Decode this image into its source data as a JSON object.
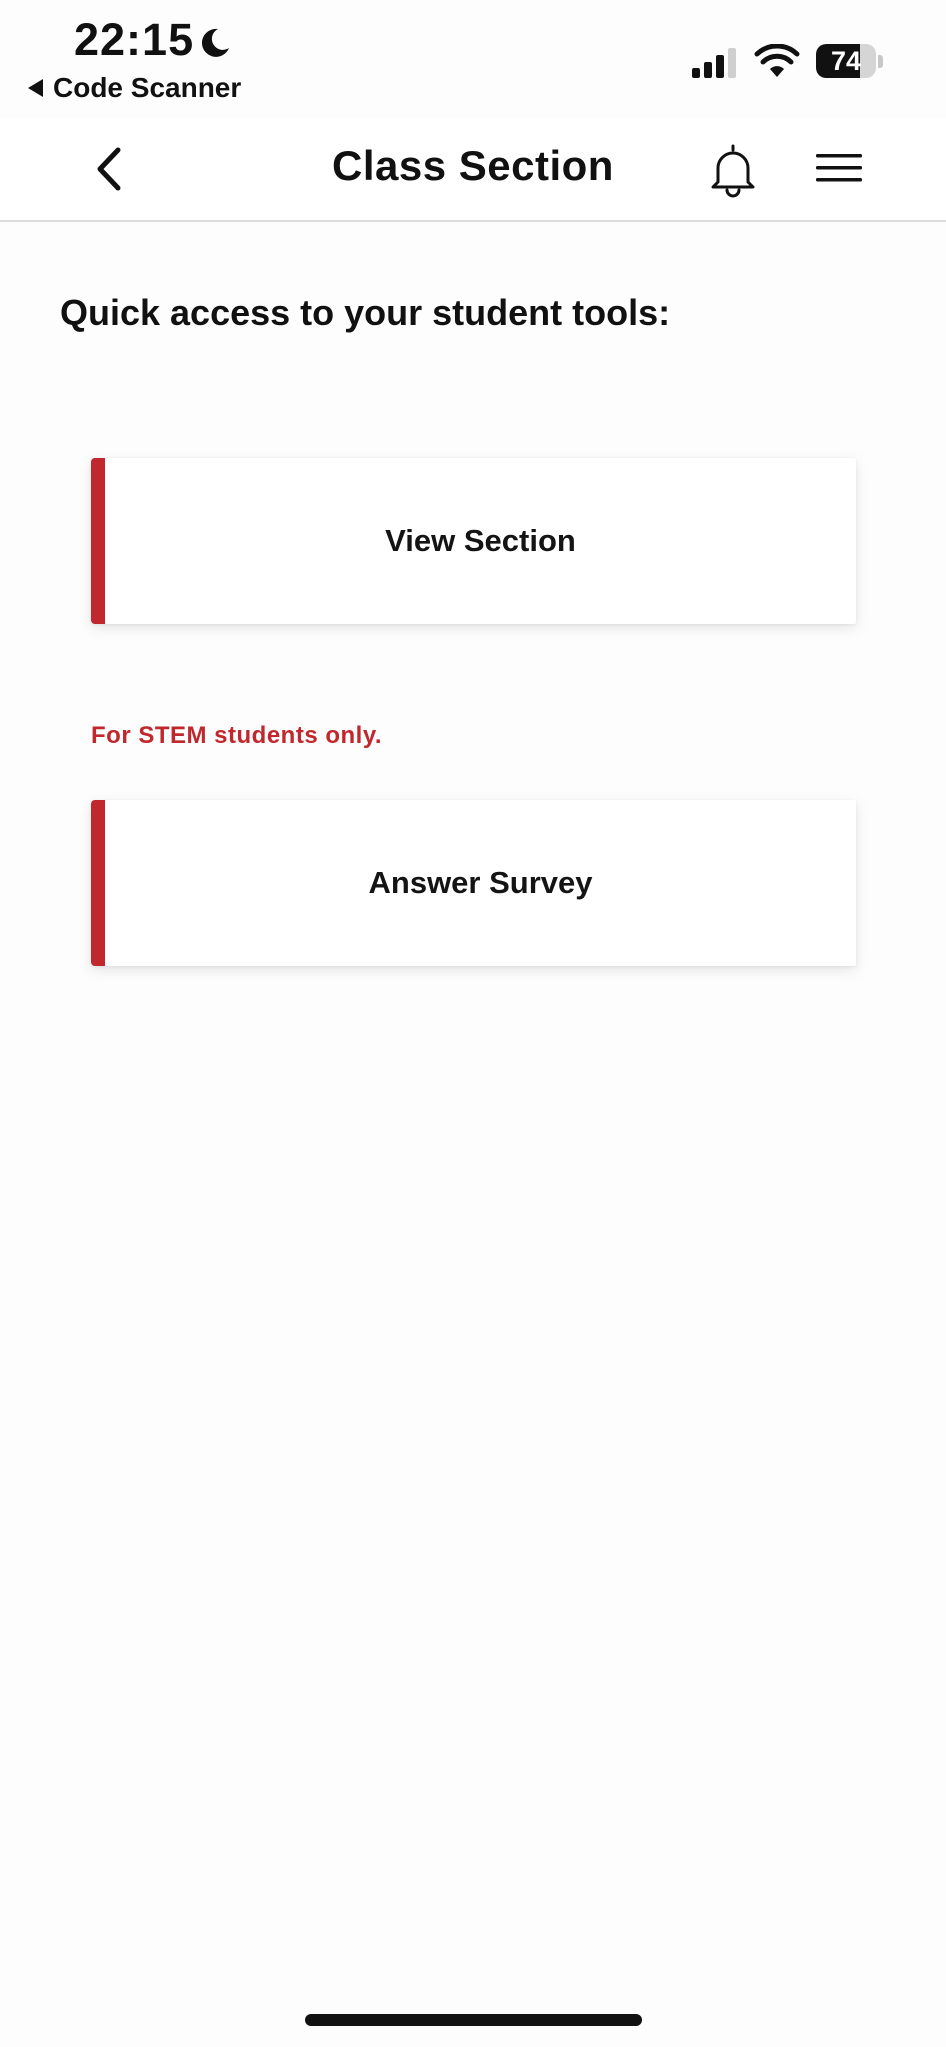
{
  "status_bar": {
    "time": "22:15",
    "back_app": "Code Scanner",
    "battery_level": "74",
    "battery_percent": 74,
    "icons": [
      "moon-icon",
      "signal-icon",
      "wifi-icon",
      "battery-icon"
    ]
  },
  "nav": {
    "title": "Class Section",
    "back_icon": "chevron-left-icon",
    "bell_icon": "bell-icon",
    "menu_icon": "hamburger-menu-icon"
  },
  "main": {
    "intro": "Quick access to your student tools:",
    "cards": [
      {
        "label": "View Section"
      },
      {
        "label": "Answer Survey"
      }
    ],
    "note": "For STEM students only."
  },
  "colors": {
    "accent": "#c0282d",
    "text": "#111111",
    "background": "#fdfdfd"
  }
}
